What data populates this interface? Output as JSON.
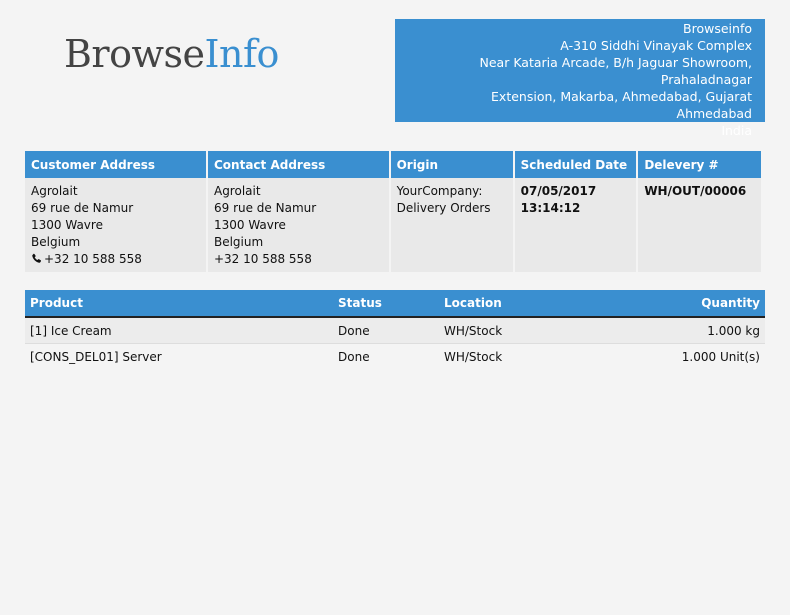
{
  "logo": {
    "part1": "Browse",
    "part2": "Info"
  },
  "company": {
    "lines": [
      "Browseinfo",
      "A-310 Siddhi Vinayak Complex",
      "Near Kataria Arcade, B/h Jaguar Showroom, Prahaladnagar",
      "Extension, Makarba, Ahmedabad, Gujarat",
      "Ahmedabad",
      "India"
    ]
  },
  "info": {
    "headers": {
      "customer": "Customer Address",
      "contact": "Contact Address",
      "origin": "Origin",
      "scheduled": "Scheduled Date",
      "delivery": "Delevery #"
    },
    "customer": [
      "Agrolait",
      "69 rue de Namur",
      "1300 Wavre",
      "Belgium",
      "+32 10 588 558"
    ],
    "contact": [
      "Agrolait",
      "69 rue de Namur",
      "1300 Wavre",
      "Belgium",
      "+32 10 588 558"
    ],
    "origin": [
      "YourCompany:",
      "Delivery Orders"
    ],
    "scheduled": "07/05/2017 13:14:12",
    "delivery": "WH/OUT/00006"
  },
  "lines": {
    "headers": {
      "product": "Product",
      "status": "Status",
      "location": "Location",
      "quantity": "Quantity"
    },
    "rows": [
      {
        "product": "[1] Ice Cream",
        "status": "Done",
        "location": "WH/Stock",
        "quantity": "1.000 kg"
      },
      {
        "product": "[CONS_DEL01] Server",
        "status": "Done",
        "location": "WH/Stock",
        "quantity": "1.000 Unit(s)"
      }
    ]
  },
  "icons": {
    "phone": "phone-icon"
  }
}
